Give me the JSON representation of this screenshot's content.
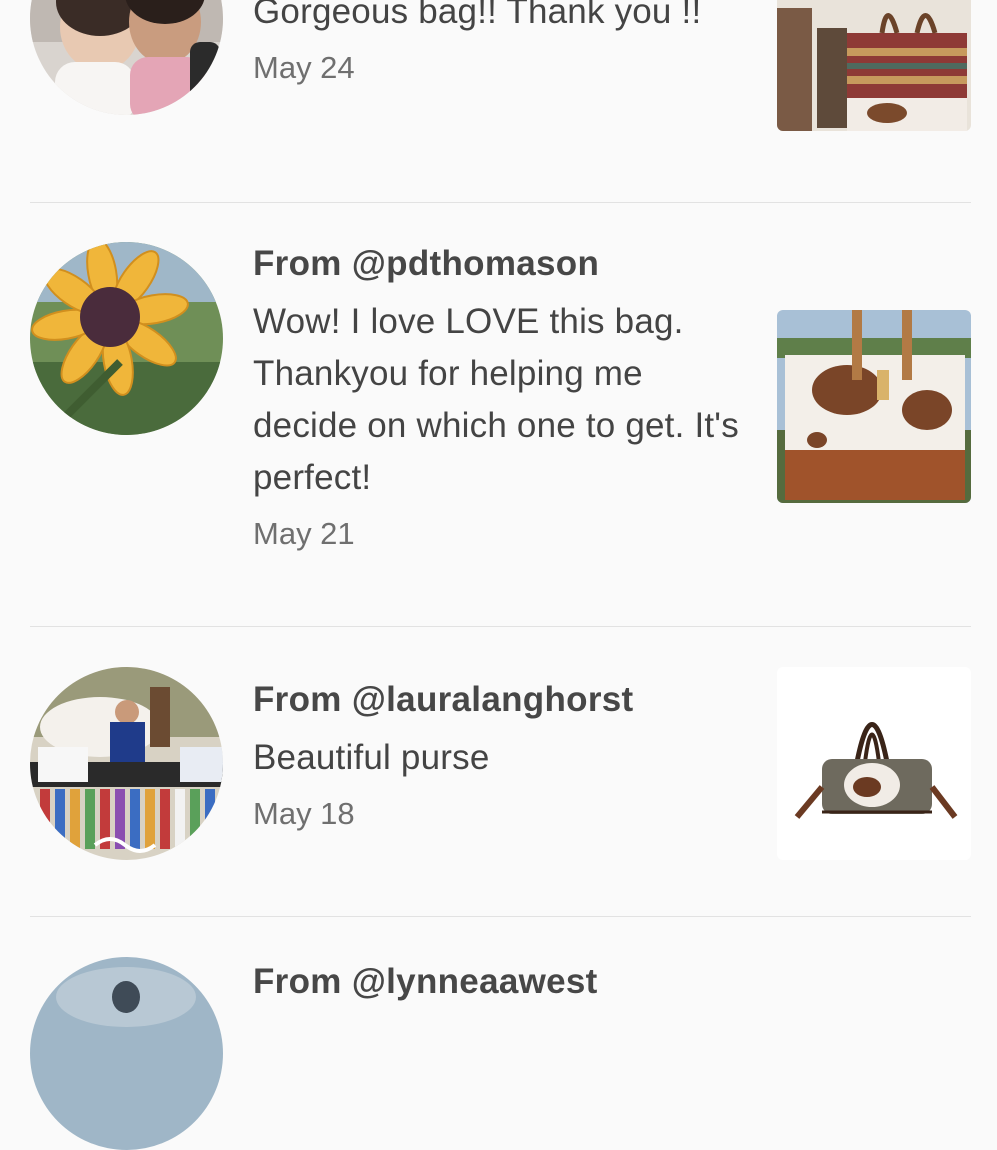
{
  "reviews": [
    {
      "from": "",
      "message": "Gorgeous bag!! Thank you !!",
      "date": "May 24",
      "avatar_icon": "avatar-photo-two-girls",
      "thumb_icon": "product-photo-striped-cowhide-tote"
    },
    {
      "from": "From @pdthomason",
      "message": "Wow! I love LOVE this bag. Thankyou for helping me decide on which one to get. It's perfect!",
      "date": "May 21",
      "avatar_icon": "avatar-photo-sunflower",
      "thumb_icon": "product-photo-cowhide-tote"
    },
    {
      "from": "From @lauralanghorst",
      "message": "Beautiful purse",
      "date": "May 18",
      "avatar_icon": "avatar-photo-horse-ribbons",
      "thumb_icon": "product-photo-fringe-satchel"
    },
    {
      "from": "From @lynneaawest",
      "message": "",
      "date": "",
      "avatar_icon": "avatar-photo-blue-painting",
      "thumb_icon": ""
    }
  ],
  "colors": {
    "background": "#fafafa",
    "divider": "#e2e2e2",
    "text": "#444444",
    "muted": "#6f6f6f"
  }
}
